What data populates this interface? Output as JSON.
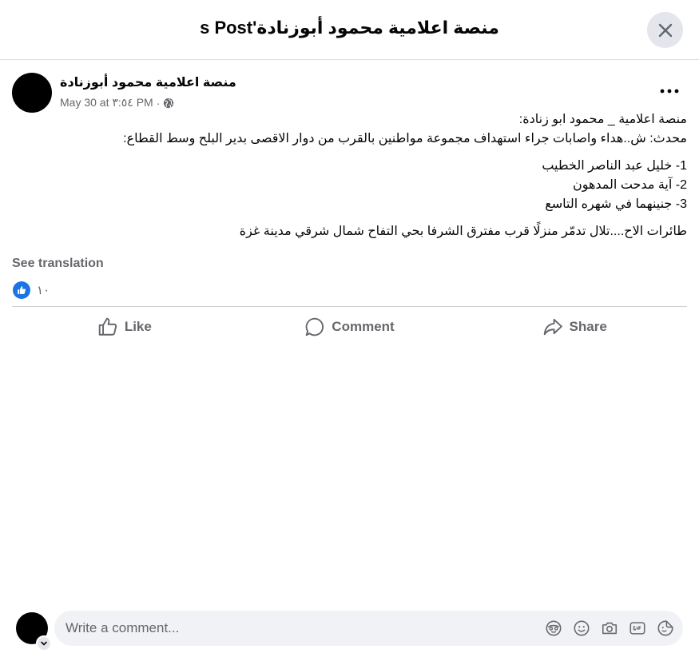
{
  "header": {
    "title": "منصة اعلامية محمود أبوزنادة's Post"
  },
  "post": {
    "author": "منصة اعلامية محمود أبوزنادة",
    "date": "May 30 at ٣:٥٤ PM",
    "separator": "·",
    "paragraphs": {
      "intro_1": "منصة اعلامية _ محمود ابو زنادة:",
      "intro_2": "محدث: ش..هداء واصابات جراء استهداف مجموعة مواطنين بالقرب من دوار الاقصى بدير البلح وسط القطاع:",
      "list_1": "1- خليل عبد الناصر الخطيب",
      "list_2": "2- آية مدحت المدهون",
      "list_3": "3- جنينهما في شهره التاسع",
      "closing": "طائرات الاح....تلال تدمّر منزلًا قرب مفترق الشرفا بحي التفاح شمال شرقي مدينة غزة"
    },
    "see_translation": "See translation",
    "reaction_count": "١٠"
  },
  "actions": {
    "like": "Like",
    "comment": "Comment",
    "share": "Share"
  },
  "composer": {
    "placeholder": "Write a comment..."
  },
  "colors": {
    "accent": "#1b74e4",
    "secondary_text": "#65676b",
    "divider": "#ced0d4",
    "input_bg": "#f0f2f5"
  },
  "icons": {
    "close": "close-icon",
    "more": "more-dots-icon",
    "audience": "globe-icon",
    "like_reaction": "thumbs-up-icon",
    "like": "like-icon",
    "comment": "comment-icon",
    "share": "share-icon",
    "avatar_sticker": "avatar-sticker-icon",
    "emoji": "emoji-icon",
    "camera": "camera-icon",
    "gif": "gif-icon",
    "sticker": "sticker-icon",
    "chevron": "chevron-down-icon"
  }
}
